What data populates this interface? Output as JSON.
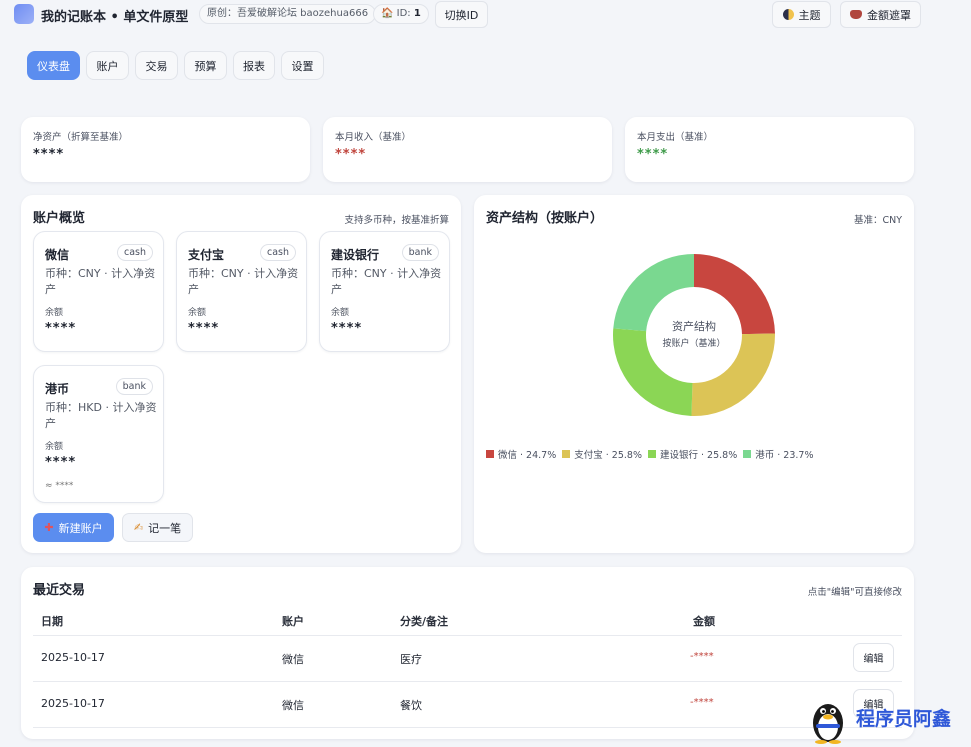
{
  "header": {
    "title": "我的记账本 • 单文件原型",
    "credit": "原创：吾爱破解论坛 baozehua666",
    "id_label": "ID:",
    "id_value": "1",
    "switch_id": "切换ID",
    "theme": "主题",
    "mask": "金额遮罩"
  },
  "nav": {
    "tabs": [
      {
        "label": "仪表盘",
        "active": true
      },
      {
        "label": "账户",
        "active": false
      },
      {
        "label": "交易",
        "active": false
      },
      {
        "label": "预算",
        "active": false
      },
      {
        "label": "报表",
        "active": false
      },
      {
        "label": "设置",
        "active": false
      }
    ]
  },
  "stats": [
    {
      "label": "净资产（折算至基准）",
      "value": "****",
      "color": "#1f2430"
    },
    {
      "label": "本月收入（基准）",
      "value": "****",
      "color": "#c0453d"
    },
    {
      "label": "本月支出（基准）",
      "value": "****",
      "color": "#3f9b4a"
    }
  ],
  "accounts": {
    "title": "账户概览",
    "note": "支持多币种，按基准折算",
    "items": [
      {
        "name": "微信",
        "tag": "cash",
        "desc": "币种：CNY · 计入净资产",
        "balance_label": "余额",
        "balance": "****",
        "approx": ""
      },
      {
        "name": "支付宝",
        "tag": "cash",
        "desc": "币种：CNY · 计入净资产",
        "balance_label": "余额",
        "balance": "****",
        "approx": ""
      },
      {
        "name": "建设银行",
        "tag": "bank",
        "desc": "币种：CNY · 计入净资产",
        "balance_label": "余额",
        "balance": "****",
        "approx": ""
      },
      {
        "name": "港币",
        "tag": "bank",
        "desc": "币种：HKD · 计入净资产",
        "balance_label": "余额",
        "balance": "****",
        "approx": "≈ ****"
      }
    ],
    "new_account": "新建账户",
    "record": "记一笔"
  },
  "structure": {
    "title": "资产结构（按账户）",
    "note": "基准：CNY",
    "center_title": "资产结构",
    "center_sub": "按账户（基准）"
  },
  "chart_data": {
    "type": "pie",
    "categories": [
      "微信",
      "支付宝",
      "建设银行",
      "港币"
    ],
    "values": [
      24.7,
      25.8,
      25.8,
      23.7
    ],
    "legend_labels": [
      "微信 · 24.7%",
      "支付宝 · 25.8%",
      "建设银行 · 25.8%",
      "港币 · 23.7%"
    ],
    "colors": [
      "#c8463f",
      "#dcc456",
      "#8bd655",
      "#7ad890"
    ],
    "title": "资产结构",
    "legend": "bottom"
  },
  "transactions": {
    "title": "最近交易",
    "note": "点击\"编辑\"可直接修改",
    "headers": [
      "日期",
      "账户",
      "分类/备注",
      "金额"
    ],
    "rows": [
      {
        "date": "2025-10-17",
        "account": "微信",
        "category": "医疗",
        "amount": "-****",
        "edit": "编辑"
      },
      {
        "date": "2025-10-17",
        "account": "微信",
        "category": "餐饮",
        "amount": "-****",
        "edit": "编辑"
      }
    ]
  },
  "watermark": {
    "text": "程序员阿鑫"
  }
}
